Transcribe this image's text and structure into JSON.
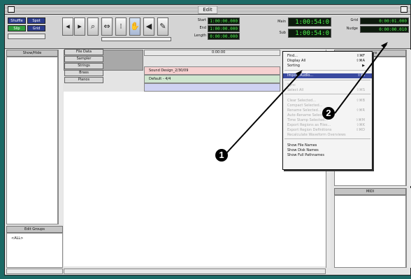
{
  "window": {
    "title": "Edit"
  },
  "toolbar": {
    "modes": [
      "Shuffle",
      "Spot",
      "Slip",
      "Grid"
    ],
    "counters": {
      "start_label": "Start",
      "start": "1:00:00.000",
      "end_label": "End",
      "end": "1:00:00.000",
      "length_label": "Length",
      "length": "0:00:00.000",
      "main_label": "Main",
      "main": "1:00:54:0",
      "sub_label": "Sub",
      "sub": "1:00:54:0",
      "grid_label": "Grid",
      "grid": "0:00:01.000",
      "nudge_label": "Nudge",
      "nudge": "0:00:00.010"
    }
  },
  "left_panel": {
    "header": "Show/Hide",
    "tracks": [
      "Sampler",
      "Strings",
      "Brass",
      "Pianos"
    ]
  },
  "groups_panel": {
    "header": "Edit Groups",
    "item": "<ALL>"
  },
  "timeline": {
    "ruler": "0:00:00",
    "tracks": [
      {
        "name": "Sound Design_2/30/09"
      },
      {
        "name": "Default - 4/4"
      },
      {
        "name": ""
      }
    ]
  },
  "menu": {
    "items": [
      {
        "label": "Find...",
        "shortcut": "⇧⌘F",
        "disabled": false
      },
      {
        "label": "Display All",
        "shortcut": "⇧⌘A",
        "disabled": false
      },
      {
        "label": "Sorting",
        "shortcut": "▶",
        "disabled": false
      },
      {
        "label": "Import Audio...",
        "shortcut": "⇧⌘I",
        "highlight": true
      },
      {
        "label": "Sync",
        "shortcut": "",
        "disabled": true
      },
      {
        "label": "Select All",
        "shortcut": "⇧⌘S",
        "disabled": true
      },
      {
        "label": "Clear Selected...",
        "shortcut": "⇧⌘B",
        "disabled": true
      },
      {
        "label": "Compact Selected...",
        "shortcut": "",
        "disabled": true
      },
      {
        "label": "Rename Selected...",
        "shortcut": "⇧⌘R",
        "disabled": true
      },
      {
        "label": "Auto-Rename Selected...",
        "shortcut": "",
        "disabled": true
      },
      {
        "label": "Time Stamp Selected...",
        "shortcut": "⇧⌘M",
        "disabled": true
      },
      {
        "label": "Export Regions as Files...",
        "shortcut": "⇧⌘K",
        "disabled": true
      },
      {
        "label": "Export Region Definitions",
        "shortcut": "⇧⌘D",
        "disabled": true
      },
      {
        "label": "Recalculate Waveform Overviews",
        "shortcut": "",
        "disabled": true
      },
      {
        "label": "Show File Names",
        "shortcut": "",
        "disabled": false
      },
      {
        "label": "Show Disk Names",
        "shortcut": "",
        "disabled": false
      },
      {
        "label": "Show Full Pathnames",
        "shortcut": "",
        "disabled": false
      }
    ]
  },
  "right_panel": {
    "header": "Regions",
    "lower_header": "MIDI"
  },
  "callouts": [
    "1",
    "2"
  ],
  "colors": {
    "desktop": "#1c6a66",
    "menu_highlight": "#3a4aa0",
    "track1": "#f6d0d0",
    "track2": "#cfe6cf",
    "track3": "#cfd2f2"
  }
}
